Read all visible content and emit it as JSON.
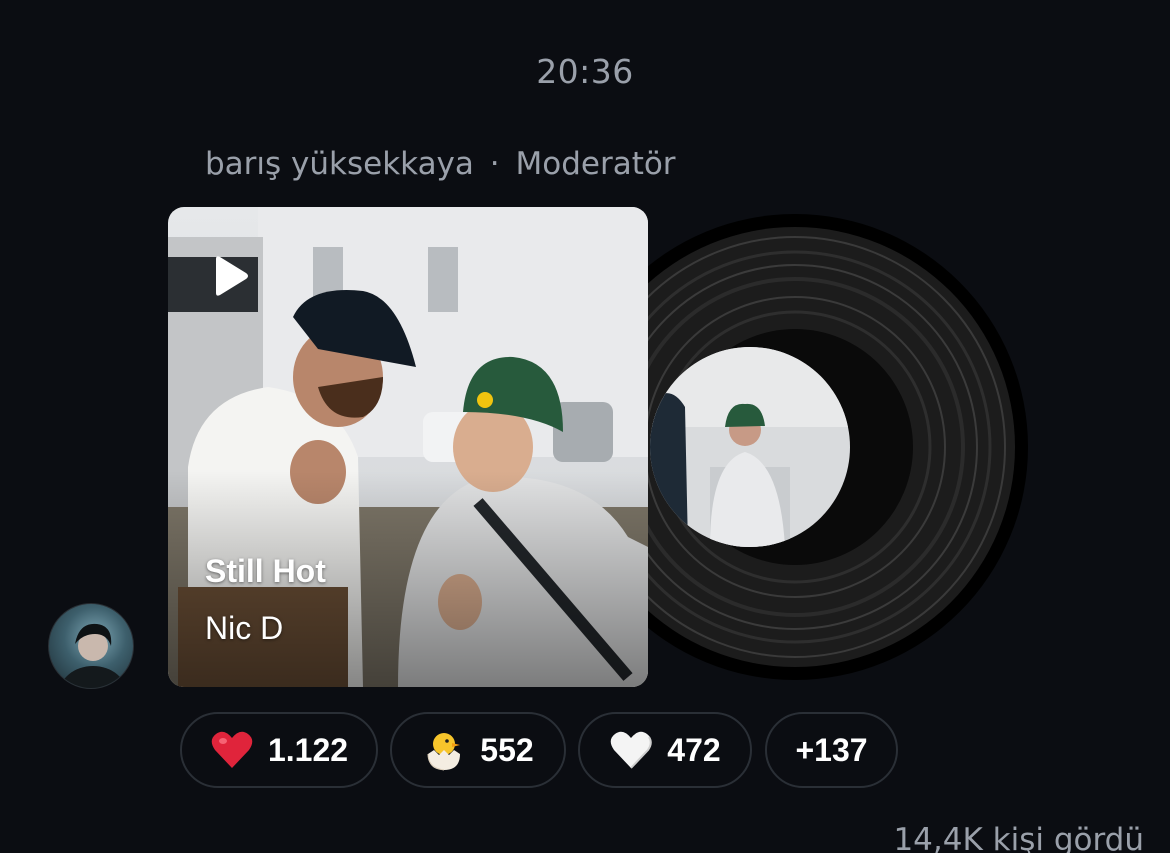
{
  "message": {
    "time": "20:36",
    "sender_name": "barış yüksekkaya",
    "separator": "·",
    "sender_role": "Moderatör",
    "avatar_icon": "user-avatar"
  },
  "music_card": {
    "song_title": "Still Hot",
    "artist": "Nic D",
    "play_icon": "play-icon",
    "vinyl_icon": "vinyl-record"
  },
  "reactions": [
    {
      "emoji": "red-heart",
      "count": "1.122"
    },
    {
      "emoji": "hatching-chick",
      "count": "552"
    },
    {
      "emoji": "white-heart",
      "count": "472"
    },
    {
      "emoji": "",
      "count": "+137"
    }
  ],
  "views": "14,4K kişi gördü",
  "colors": {
    "background": "#0b0d12",
    "muted_text": "#9aa0aa",
    "pill_border": "#2a2f36",
    "heart_red": "#e0243b"
  }
}
